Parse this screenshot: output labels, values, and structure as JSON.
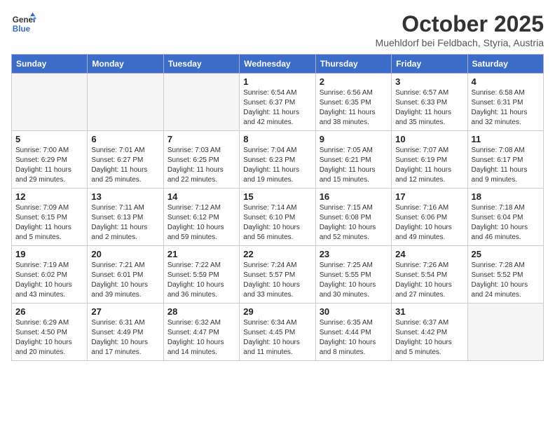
{
  "header": {
    "logo_line1": "General",
    "logo_line2": "Blue",
    "title": "October 2025",
    "subtitle": "Muehldorf bei Feldbach, Styria, Austria"
  },
  "weekdays": [
    "Sunday",
    "Monday",
    "Tuesday",
    "Wednesday",
    "Thursday",
    "Friday",
    "Saturday"
  ],
  "weeks": [
    [
      {
        "day": "",
        "empty": true
      },
      {
        "day": "",
        "empty": true
      },
      {
        "day": "",
        "empty": true
      },
      {
        "day": "1",
        "sunrise": "6:54 AM",
        "sunset": "6:37 PM",
        "daylight": "11 hours and 42 minutes."
      },
      {
        "day": "2",
        "sunrise": "6:56 AM",
        "sunset": "6:35 PM",
        "daylight": "11 hours and 38 minutes."
      },
      {
        "day": "3",
        "sunrise": "6:57 AM",
        "sunset": "6:33 PM",
        "daylight": "11 hours and 35 minutes."
      },
      {
        "day": "4",
        "sunrise": "6:58 AM",
        "sunset": "6:31 PM",
        "daylight": "11 hours and 32 minutes."
      }
    ],
    [
      {
        "day": "5",
        "sunrise": "7:00 AM",
        "sunset": "6:29 PM",
        "daylight": "11 hours and 29 minutes."
      },
      {
        "day": "6",
        "sunrise": "7:01 AM",
        "sunset": "6:27 PM",
        "daylight": "11 hours and 25 minutes."
      },
      {
        "day": "7",
        "sunrise": "7:03 AM",
        "sunset": "6:25 PM",
        "daylight": "11 hours and 22 minutes."
      },
      {
        "day": "8",
        "sunrise": "7:04 AM",
        "sunset": "6:23 PM",
        "daylight": "11 hours and 19 minutes."
      },
      {
        "day": "9",
        "sunrise": "7:05 AM",
        "sunset": "6:21 PM",
        "daylight": "11 hours and 15 minutes."
      },
      {
        "day": "10",
        "sunrise": "7:07 AM",
        "sunset": "6:19 PM",
        "daylight": "11 hours and 12 minutes."
      },
      {
        "day": "11",
        "sunrise": "7:08 AM",
        "sunset": "6:17 PM",
        "daylight": "11 hours and 9 minutes."
      }
    ],
    [
      {
        "day": "12",
        "sunrise": "7:09 AM",
        "sunset": "6:15 PM",
        "daylight": "11 hours and 5 minutes."
      },
      {
        "day": "13",
        "sunrise": "7:11 AM",
        "sunset": "6:13 PM",
        "daylight": "11 hours and 2 minutes."
      },
      {
        "day": "14",
        "sunrise": "7:12 AM",
        "sunset": "6:12 PM",
        "daylight": "10 hours and 59 minutes."
      },
      {
        "day": "15",
        "sunrise": "7:14 AM",
        "sunset": "6:10 PM",
        "daylight": "10 hours and 56 minutes."
      },
      {
        "day": "16",
        "sunrise": "7:15 AM",
        "sunset": "6:08 PM",
        "daylight": "10 hours and 52 minutes."
      },
      {
        "day": "17",
        "sunrise": "7:16 AM",
        "sunset": "6:06 PM",
        "daylight": "10 hours and 49 minutes."
      },
      {
        "day": "18",
        "sunrise": "7:18 AM",
        "sunset": "6:04 PM",
        "daylight": "10 hours and 46 minutes."
      }
    ],
    [
      {
        "day": "19",
        "sunrise": "7:19 AM",
        "sunset": "6:02 PM",
        "daylight": "10 hours and 43 minutes."
      },
      {
        "day": "20",
        "sunrise": "7:21 AM",
        "sunset": "6:01 PM",
        "daylight": "10 hours and 39 minutes."
      },
      {
        "day": "21",
        "sunrise": "7:22 AM",
        "sunset": "5:59 PM",
        "daylight": "10 hours and 36 minutes."
      },
      {
        "day": "22",
        "sunrise": "7:24 AM",
        "sunset": "5:57 PM",
        "daylight": "10 hours and 33 minutes."
      },
      {
        "day": "23",
        "sunrise": "7:25 AM",
        "sunset": "5:55 PM",
        "daylight": "10 hours and 30 minutes."
      },
      {
        "day": "24",
        "sunrise": "7:26 AM",
        "sunset": "5:54 PM",
        "daylight": "10 hours and 27 minutes."
      },
      {
        "day": "25",
        "sunrise": "7:28 AM",
        "sunset": "5:52 PM",
        "daylight": "10 hours and 24 minutes."
      }
    ],
    [
      {
        "day": "26",
        "sunrise": "6:29 AM",
        "sunset": "4:50 PM",
        "daylight": "10 hours and 20 minutes."
      },
      {
        "day": "27",
        "sunrise": "6:31 AM",
        "sunset": "4:49 PM",
        "daylight": "10 hours and 17 minutes."
      },
      {
        "day": "28",
        "sunrise": "6:32 AM",
        "sunset": "4:47 PM",
        "daylight": "10 hours and 14 minutes."
      },
      {
        "day": "29",
        "sunrise": "6:34 AM",
        "sunset": "4:45 PM",
        "daylight": "10 hours and 11 minutes."
      },
      {
        "day": "30",
        "sunrise": "6:35 AM",
        "sunset": "4:44 PM",
        "daylight": "10 hours and 8 minutes."
      },
      {
        "day": "31",
        "sunrise": "6:37 AM",
        "sunset": "4:42 PM",
        "daylight": "10 hours and 5 minutes."
      },
      {
        "day": "",
        "empty": true
      }
    ]
  ]
}
